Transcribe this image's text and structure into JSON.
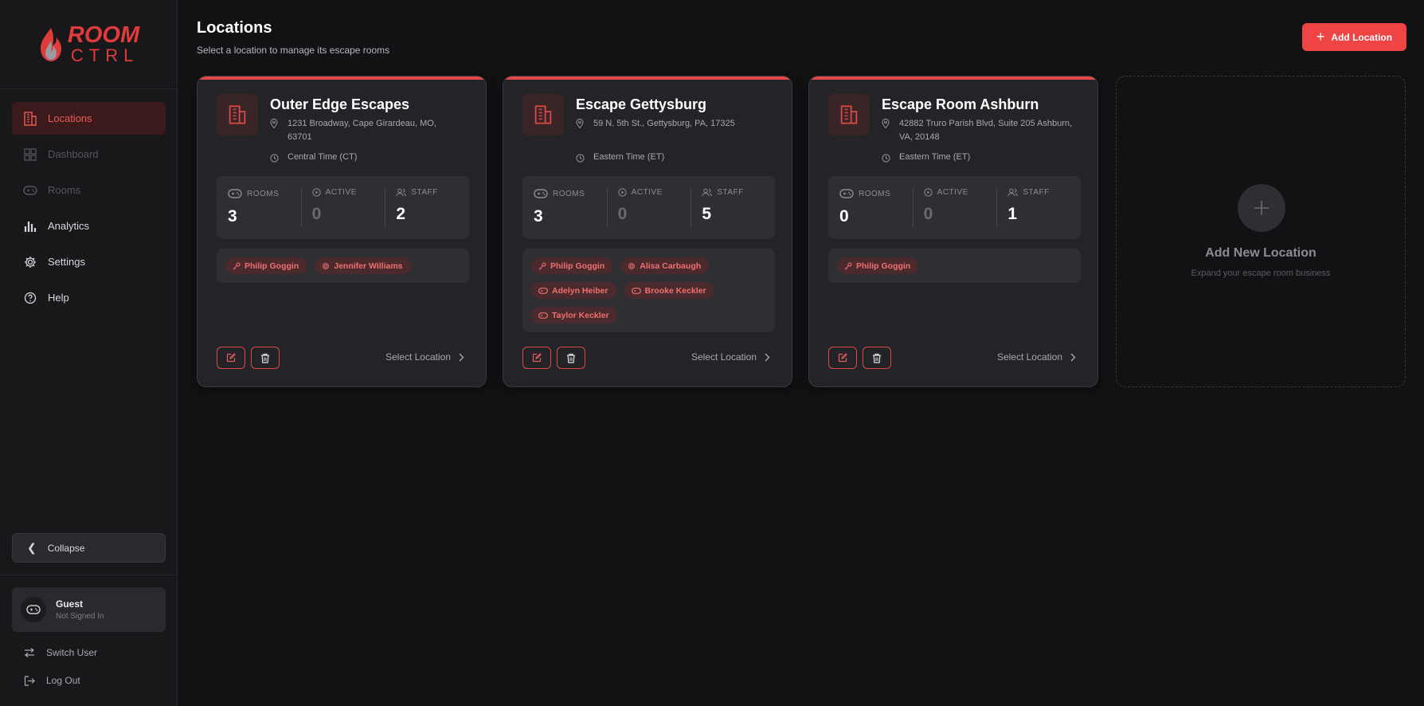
{
  "brand": {
    "line1": "ROOM",
    "line2": "CTRL"
  },
  "nav": [
    {
      "label": "Locations",
      "icon": "building-icon",
      "state": "active"
    },
    {
      "label": "Dashboard",
      "icon": "grid-icon",
      "state": "disabled"
    },
    {
      "label": "Rooms",
      "icon": "gamepad-icon",
      "state": "disabled"
    },
    {
      "label": "Analytics",
      "icon": "bar-chart-icon",
      "state": "normal"
    },
    {
      "label": "Settings",
      "icon": "gear-icon",
      "state": "normal"
    },
    {
      "label": "Help",
      "icon": "help-circle-icon",
      "state": "normal"
    }
  ],
  "sidebar": {
    "collapse_label": "Collapse",
    "user": {
      "name": "Guest",
      "status": "Not Signed In"
    },
    "switch_user_label": "Switch User",
    "logout_label": "Log Out"
  },
  "header": {
    "title": "Locations",
    "subtitle": "Select a location to manage its escape rooms",
    "add_button": "Add Location"
  },
  "stat_labels": {
    "rooms": "ROOMS",
    "active": "ACTIVE",
    "staff": "STAFF"
  },
  "select_label": "Select Location",
  "locations": [
    {
      "name": "Outer Edge Escapes",
      "address": "1231 Broadway, Cape Girardeau, MO, 63701",
      "timezone": "Central Time (CT)",
      "rooms": "3",
      "active": "0",
      "staff": "2",
      "members": [
        {
          "name": "Philip Goggin",
          "role": "key-icon"
        },
        {
          "name": "Jennifer Williams",
          "role": "gear-icon"
        }
      ]
    },
    {
      "name": "Escape Gettysburg",
      "address": "59 N. 5th St., Gettysburg, PA, 17325",
      "timezone": "Eastern Time (ET)",
      "rooms": "3",
      "active": "0",
      "staff": "5",
      "members": [
        {
          "name": "Philip Goggin",
          "role": "key-icon"
        },
        {
          "name": "Alisa Carbaugh",
          "role": "gear-icon"
        },
        {
          "name": "Adelyn Heiber",
          "role": "gamepad-icon"
        },
        {
          "name": "Brooke Keckler",
          "role": "gamepad-icon"
        },
        {
          "name": "Taylor Keckler",
          "role": "gamepad-icon"
        }
      ]
    },
    {
      "name": "Escape Room Ashburn",
      "address": "42882 Truro Parish Blvd, Suite 205 Ashburn, VA, 20148",
      "timezone": "Eastern Time (ET)",
      "rooms": "0",
      "active": "0",
      "staff": "1",
      "members": [
        {
          "name": "Philip Goggin",
          "role": "key-icon"
        }
      ]
    }
  ],
  "add_card": {
    "title": "Add New Location",
    "subtitle": "Expand your escape room business"
  },
  "colors": {
    "accent": "#ee4444",
    "background": "#121214",
    "card": "#242428"
  }
}
